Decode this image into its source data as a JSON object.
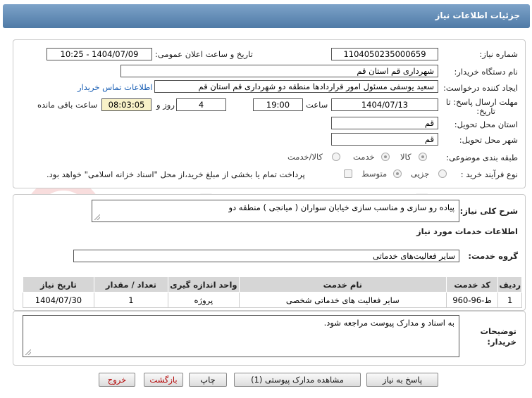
{
  "title": "جزئیات اطلاعات نیاز",
  "fields": {
    "need_number_label": "شماره نیاز:",
    "need_number": "1104050235000659",
    "announce_label": "تاریخ و ساعت اعلان عمومی:",
    "announce_value": "1404/07/09 - 10:25",
    "buyer_org_label": "نام دستگاه خریدار:",
    "buyer_org": "شهرداری قم استان قم",
    "creator_label": "ایجاد کننده درخواست:",
    "creator": "سعید یوسفی مسئول امور قراردادها منطقه دو شهرداری قم استان قم",
    "contact_link": "اطلاعات تماس خریدار",
    "deadline_label_1": "مهلت ارسال پاسخ: تا",
    "deadline_label_2": "تاریخ:",
    "deadline_date": "1404/07/13",
    "time_label": "ساعت",
    "deadline_time": "19:00",
    "days": "4",
    "days_label": "روز و",
    "remaining": "08:03:05",
    "remaining_label": "ساعت باقی مانده",
    "province_label": "استان محل تحویل:",
    "province": "قم",
    "city_label": "شهر محل تحویل:",
    "city": "قم",
    "category_label": "طبقه بندی موضوعی:",
    "category_options": [
      "کالا",
      "خدمت",
      "کالا/خدمت"
    ],
    "category_selected": "خدمت",
    "process_label": "نوع فرآیند خرید :",
    "process_options": [
      "جزیی",
      "متوسط"
    ],
    "process_selected": "متوسط",
    "payment_note": "پرداخت تمام یا بخشی از مبلغ خرید،از محل \"اسناد خزانه اسلامی\" خواهد بود."
  },
  "summary": {
    "label": "شرح کلی نیاز:",
    "text": "پیاده رو سازی و مناسب سازی خیابان سواران ( میانجی ) منطقه دو"
  },
  "services": {
    "heading": "اطلاعات خدمات مورد نیاز",
    "group_label": "گروه خدمت:",
    "group_value": "سایر فعالیت‌های خدماتی",
    "columns": [
      "ردیف",
      "کد خدمت",
      "نام خدمت",
      "واحد اندازه گیری",
      "تعداد / مقدار",
      "تاریخ نیاز"
    ],
    "rows": [
      [
        "1",
        "ط-96-960",
        "سایر فعالیت های خدماتی شخصی",
        "پروژه",
        "1",
        "1404/07/30"
      ]
    ]
  },
  "buyer_notes": {
    "label_1": "توضیحات",
    "label_2": "خریدار:",
    "text": "به اسناد و مدارک پیوست مراجعه شود."
  },
  "buttons": {
    "reply": "پاسخ به نیاز",
    "attachments": "مشاهده مدارک پیوستی (1)",
    "print": "چاپ",
    "back": "بازگشت",
    "exit": "خروج"
  },
  "colors": {
    "title_bar": "#5f8ab5",
    "link": "#1a5fb4",
    "timer_bg": "#f8f1c8",
    "exit_text": "#b30000"
  }
}
